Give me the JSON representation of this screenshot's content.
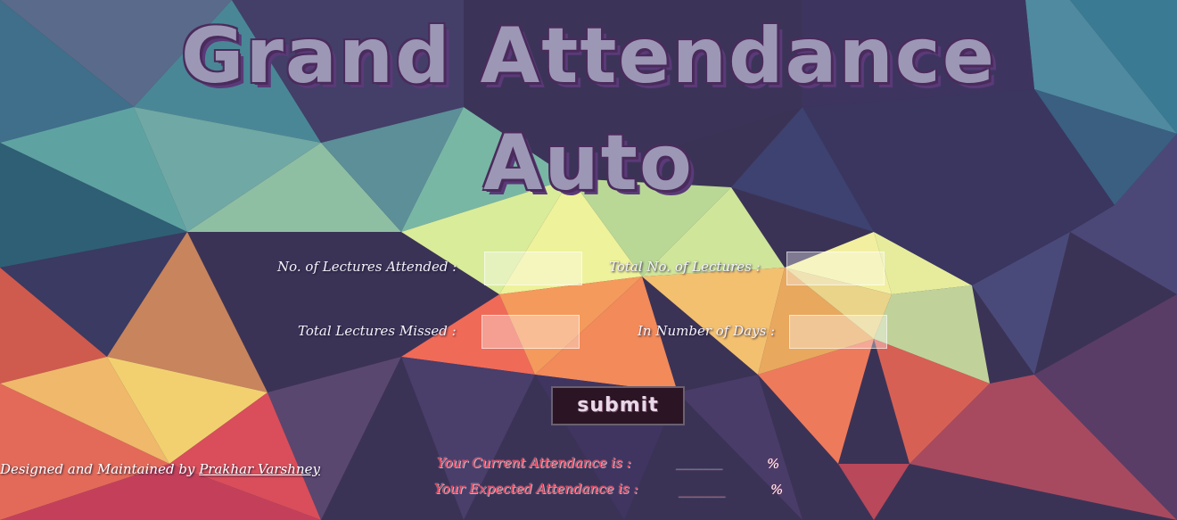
{
  "header": {
    "title_line1": "Grand Attendance",
    "title_line2": "Auto"
  },
  "form": {
    "attended_label": "No. of Lectures Attended :",
    "total_label": "Total No. of Lectures :",
    "missed_label": "Total Lectures Missed :",
    "days_label": "In Number of Days :",
    "attended_value": "",
    "total_value": "",
    "missed_value": "",
    "days_value": "",
    "submit_label": "submit"
  },
  "footer": {
    "credit_prefix": "Designed and Maintained by",
    "author_name": "Prakhar Varshney"
  },
  "results": {
    "current_label": "Your Current Attendance is :",
    "current_value": "_______",
    "current_unit": "%",
    "expected_label": "Your Expected Attendance is :",
    "expected_value": "_______",
    "expected_unit": "%"
  },
  "colors": {
    "title_fill": "#9d97b6",
    "title_outline": "#4a2b5c",
    "result_text": "#e23a54",
    "button_bg": "#2b1424"
  }
}
